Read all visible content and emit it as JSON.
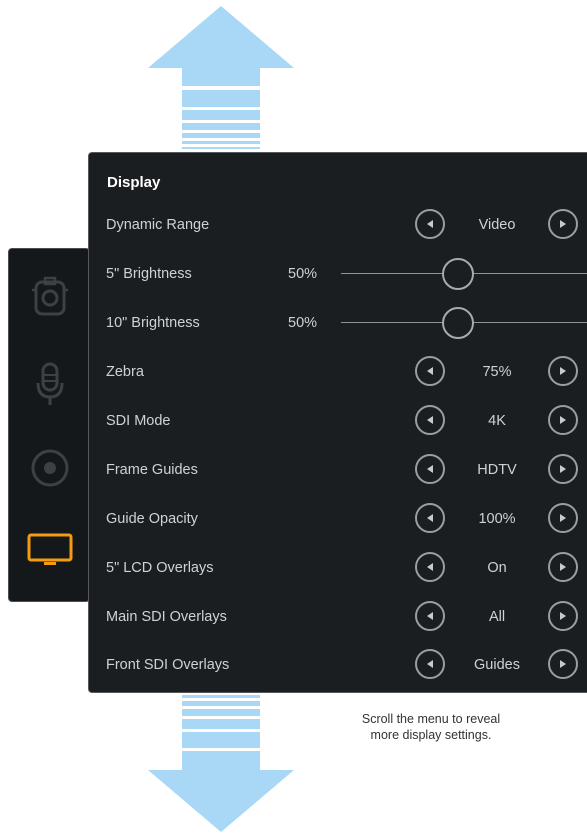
{
  "panel": {
    "title": "Display",
    "rows": [
      {
        "label": "Dynamic Range",
        "value": "Video"
      },
      {
        "label": "5\" Brightness",
        "value": "50%"
      },
      {
        "label": "10\" Brightness",
        "value": "50%"
      },
      {
        "label": "Zebra",
        "value": "75%"
      },
      {
        "label": "SDI Mode",
        "value": "4K"
      },
      {
        "label": "Frame Guides",
        "value": "HDTV"
      },
      {
        "label": "Guide Opacity",
        "value": "100%"
      },
      {
        "label": "5\" LCD Overlays",
        "value": "On"
      },
      {
        "label": "Main SDI Overlays",
        "value": "All"
      },
      {
        "label": "Front SDI Overlays",
        "value": "Guides"
      }
    ],
    "sliders": {
      "brightness_5": 0.5,
      "brightness_10": 0.5
    }
  },
  "sidebar": {
    "icons": [
      "camera-icon",
      "microphone-icon",
      "record-icon",
      "monitor-icon"
    ],
    "active": "monitor-icon"
  },
  "caption": {
    "line1": "Scroll the menu to reveal",
    "line2": "more display settings."
  },
  "colors": {
    "arrow": "#a8d8f5",
    "active_accent": "#f39c12",
    "panel_bg": "#1b1e21"
  }
}
